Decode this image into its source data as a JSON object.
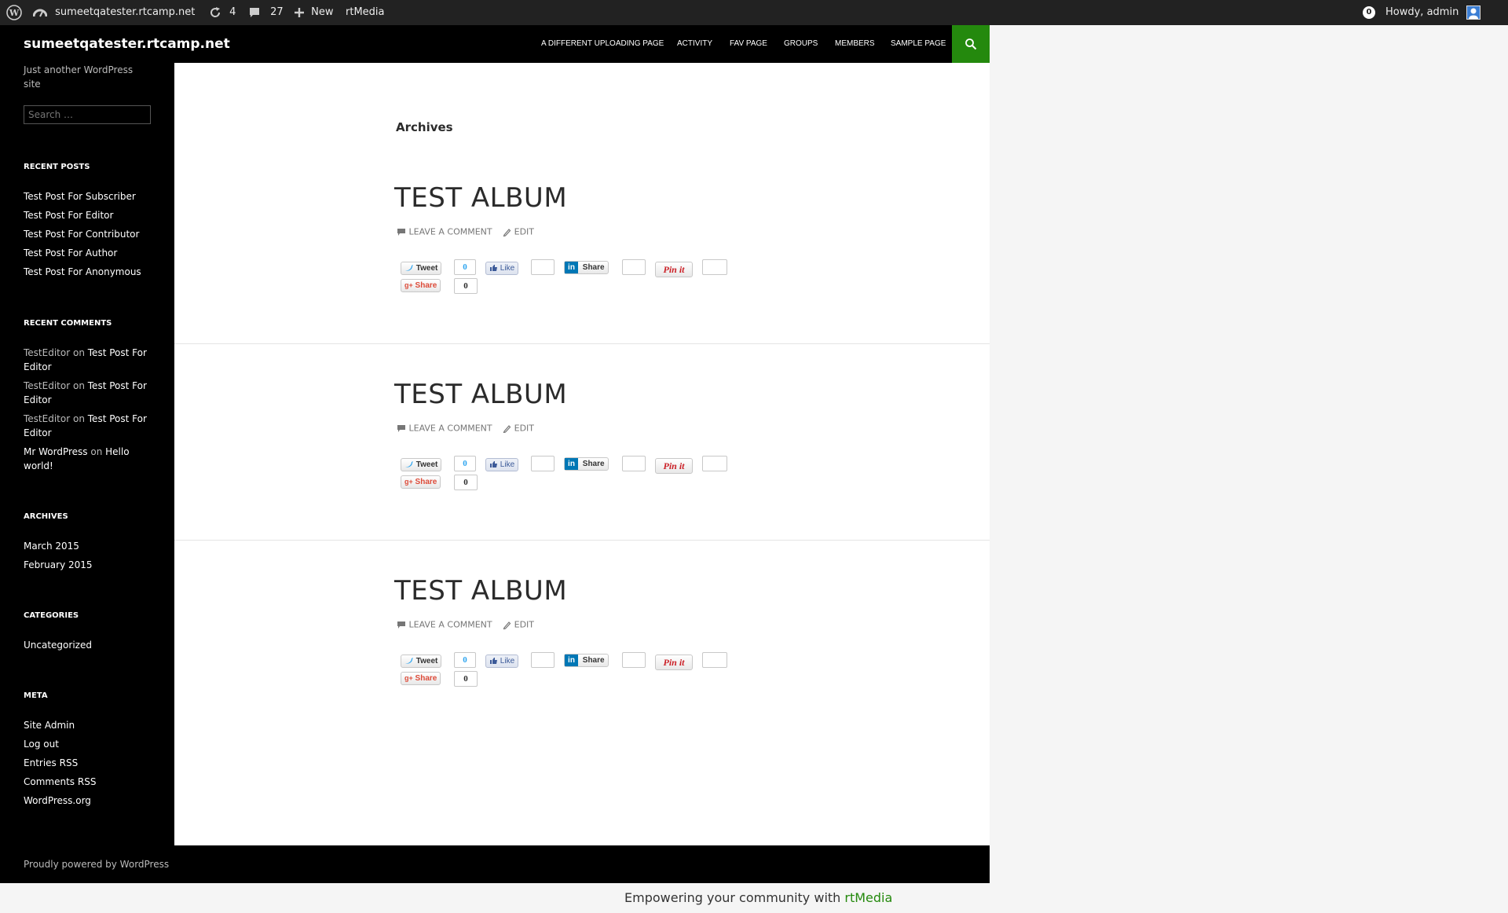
{
  "adminbar": {
    "site_name": "sumeetqatester.rtcamp.net",
    "updates_count": "4",
    "comments_count": "27",
    "new_label": "New",
    "rtmedia_label": "rtMedia",
    "notif_count": "0",
    "howdy": "Howdy, admin"
  },
  "header": {
    "site_title": "sumeetqatester.rtcamp.net",
    "nav": [
      "A DIFFERENT UPLOADING PAGE",
      "ACTIVITY",
      "FAV PAGE",
      "GROUPS",
      "MEMBERS",
      "SAMPLE PAGE"
    ]
  },
  "sidebar": {
    "tagline": "Just another WordPress site",
    "search_placeholder": "Search …",
    "recent_posts_title": "RECENT POSTS",
    "recent_posts": [
      "Test Post For Subscriber",
      "Test Post For Editor",
      "Test Post For Contributor",
      "Test Post For Author",
      "Test Post For Anonymous"
    ],
    "recent_comments_title": "RECENT COMMENTS",
    "recent_comments": [
      {
        "author": "TestEditor",
        "on": "on",
        "post": "Test Post For Editor"
      },
      {
        "author": "TestEditor",
        "on": "on",
        "post": "Test Post For Editor"
      },
      {
        "author": "TestEditor",
        "on": "on",
        "post": "Test Post For Editor"
      },
      {
        "author": "Mr WordPress",
        "on": "on",
        "post": "Hello world!"
      }
    ],
    "archives_title": "ARCHIVES",
    "archives": [
      "March 2015",
      "February 2015"
    ],
    "categories_title": "CATEGORIES",
    "categories": [
      "Uncategorized"
    ],
    "meta_title": "META",
    "meta": [
      "Site Admin",
      "Log out",
      "Entries RSS",
      "Comments RSS",
      "WordPress.org"
    ]
  },
  "main": {
    "archives_heading": "Archives",
    "posts": [
      {
        "title": "TEST ALBUM",
        "comment_label": "LEAVE A COMMENT",
        "edit_label": "EDIT",
        "tweet_count": "0",
        "gplus_count": "0"
      },
      {
        "title": "TEST ALBUM",
        "comment_label": "LEAVE A COMMENT",
        "edit_label": "EDIT",
        "tweet_count": "0",
        "gplus_count": "0"
      },
      {
        "title": "TEST ALBUM",
        "comment_label": "LEAVE A COMMENT",
        "edit_label": "EDIT",
        "tweet_count": "0",
        "gplus_count": "0"
      }
    ],
    "share": {
      "tweet": "Tweet",
      "like": "Like",
      "linkedin": "Share",
      "pinit": "Pin it",
      "gplus": "Share"
    }
  },
  "footer": {
    "powered": "Proudly powered by WordPress"
  },
  "rtmedia_footer": {
    "text": "Empowering your community with",
    "link": "rtMedia"
  },
  "colors": {
    "accent": "#24890d",
    "adminbar": "#222222",
    "dark": "#000000"
  }
}
